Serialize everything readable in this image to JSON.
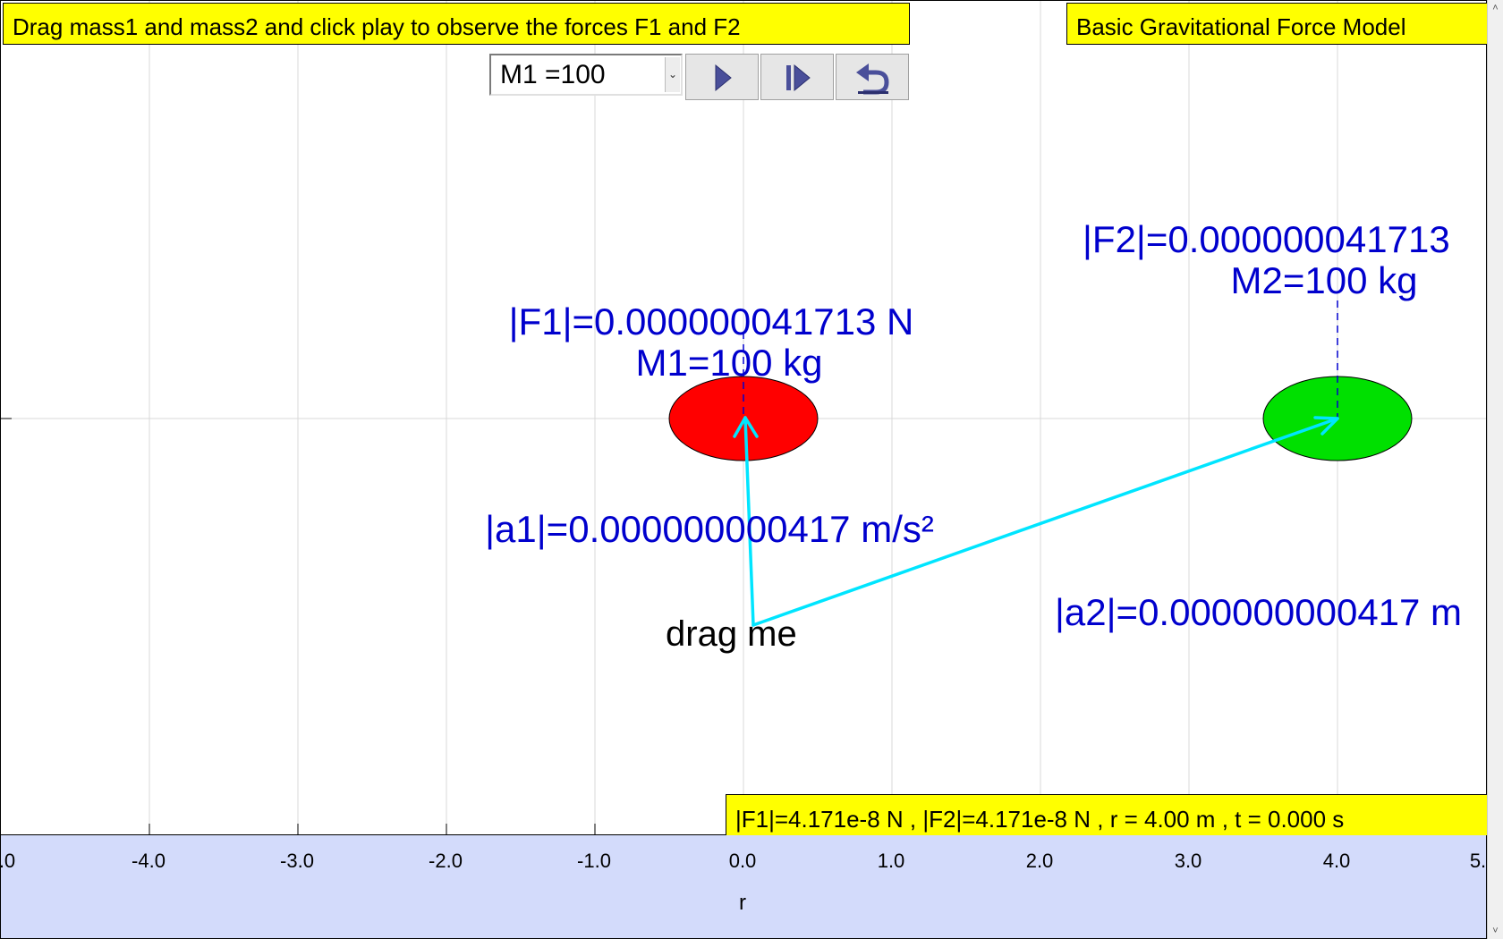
{
  "header": {
    "instructions": "Drag mass1 and mass2 and click play to observe the forces F1 and F2",
    "model_title": "Basic Gravitational Force Model"
  },
  "toolbar": {
    "mass_select_value": "M1 =100",
    "play_icon": "play-icon",
    "step_icon": "step-forward-icon",
    "reset_icon": "reset-icon"
  },
  "mass1": {
    "force_label": "|F1|=0.000000041713 N",
    "mass_label": "M1=100 kg",
    "accel_label": "|a1|=0.000000000417 m/s²",
    "color": "#ff0000",
    "x": 0.0
  },
  "mass2": {
    "force_label": "|F2|=0.000000041713",
    "mass_label": "M2=100 kg",
    "accel_label": "|a2|=0.000000000417 m",
    "color": "#00e000",
    "x": 4.0
  },
  "drag_handle": {
    "label": "drag me"
  },
  "readout": "|F1|=4.171e-8 N , |F2|=4.171e-8 N , r = 4.00 m , t = 0.000 s",
  "axis": {
    "title": "r",
    "ticks": [
      ".0",
      "-4.0",
      "-3.0",
      "-2.0",
      "-1.0",
      "0.0",
      "1.0",
      "2.0",
      "3.0",
      "4.0",
      "5."
    ]
  },
  "colors": {
    "label_blue": "#0000cd",
    "arrow_cyan": "#00e5ff",
    "highlight_yellow": "#ffff00",
    "axis_panel": "#d3dbfb"
  }
}
